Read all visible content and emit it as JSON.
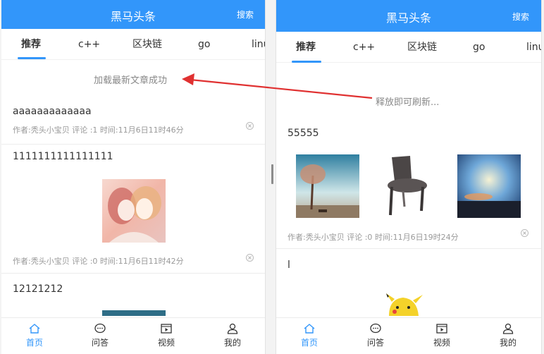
{
  "left": {
    "header": {
      "title": "黑马头条",
      "search": "搜索"
    },
    "tabs": [
      "推荐",
      "c++",
      "区块链",
      "go",
      "linu"
    ],
    "pull_message": "加载最新文章成功",
    "articles": [
      {
        "title": "aaaaaaaaaaaaa",
        "meta": "作者:秃头小宝贝 评论 :1 时间:11月6日11时46分"
      },
      {
        "title": "1111111111111111",
        "meta": "作者:秃头小宝贝 评论 :0 时间:11月6日11时42分"
      },
      {
        "title": "12121212"
      }
    ]
  },
  "right": {
    "header": {
      "title": "黑马头条",
      "search": "搜索"
    },
    "tabs": [
      "推荐",
      "c++",
      "区块链",
      "go",
      "linu"
    ],
    "pull_message": "释放即可刷新...",
    "articles": [
      {
        "title": "55555",
        "meta": "作者:秃头小宝贝 评论 :0 时间:11月6日19时24分"
      },
      {
        "title": "l"
      }
    ]
  },
  "tabbar": {
    "items": [
      {
        "label": "首页",
        "icon": "home-icon"
      },
      {
        "label": "问答",
        "icon": "chat-icon"
      },
      {
        "label": "视频",
        "icon": "video-icon"
      },
      {
        "label": "我的",
        "icon": "user-icon"
      }
    ]
  },
  "colors": {
    "brand": "#3296fa",
    "arrow": "#e03131"
  }
}
